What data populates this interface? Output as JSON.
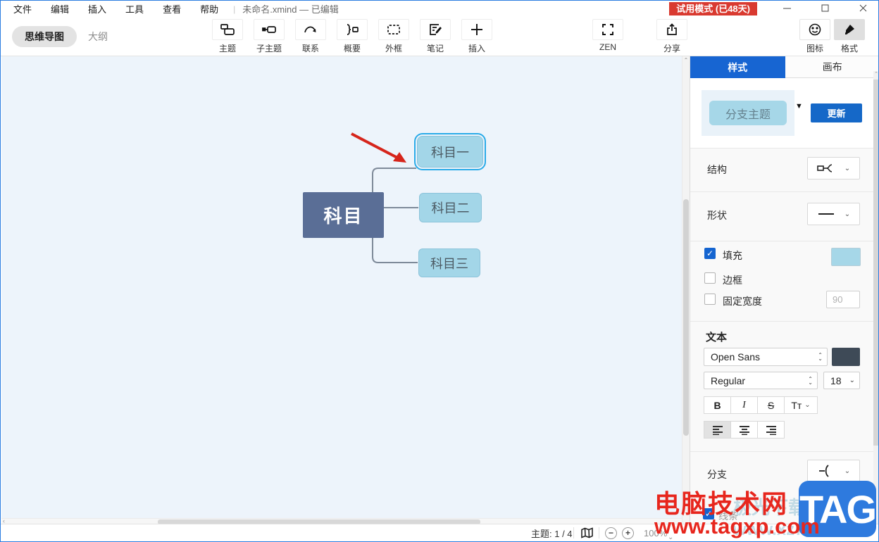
{
  "titlebar": {
    "menu_items": [
      "文件",
      "编辑",
      "插入",
      "工具",
      "查看",
      "帮助"
    ],
    "document_title": "未命名.xmind — 已编辑",
    "trial_badge": "试用模式 (已48天)",
    "trial_badge_color": "#d93a30"
  },
  "toolbar": {
    "view_tabs": [
      {
        "label": "思维导图",
        "active": true
      },
      {
        "label": "大纲",
        "active": false
      }
    ],
    "tools": [
      {
        "label": "主题"
      },
      {
        "label": "子主题"
      },
      {
        "label": "联系"
      },
      {
        "label": "概要"
      },
      {
        "label": "外框"
      },
      {
        "label": "笔记"
      },
      {
        "label": "插入"
      },
      {
        "label": "ZEN"
      },
      {
        "label": "分享"
      },
      {
        "label": "图标"
      },
      {
        "label": "格式"
      }
    ],
    "active_tool": "格式"
  },
  "canvas": {
    "background": "#edf4fb",
    "mindmap": {
      "root_label": "科目",
      "children": [
        "科目一",
        "科目二",
        "科目三"
      ],
      "selected_child": "科目一",
      "root_fill": "#5a6e96",
      "child_fill": "#a3d6e8",
      "selection_color": "#2aabe8",
      "connector_color": "#7e8a99",
      "arrow_color": "#d6251b"
    }
  },
  "panel": {
    "tabs": [
      {
        "label": "样式",
        "active": true
      },
      {
        "label": "画布",
        "active": false
      }
    ],
    "preview": {
      "label": "分支主题",
      "update_button": "更新",
      "pill_fill": "#a6d7e8",
      "button_color": "#1568c8"
    },
    "structure_row": {
      "label": "结构"
    },
    "shape_row": {
      "label": "形状"
    },
    "fill_row": {
      "label": "填充",
      "checked": true,
      "swatch": "#a6d7e8"
    },
    "border_row": {
      "label": "边框",
      "checked": false
    },
    "fixed_width_row": {
      "label": "固定宽度",
      "checked": false,
      "value": "90"
    },
    "text_section": {
      "title": "文本",
      "font_family": "Open Sans",
      "font_color": "#3e4a57",
      "font_weight": "Regular",
      "font_size": "18",
      "bold": "B",
      "italic": "I",
      "strike": "S",
      "case": "Tт"
    },
    "branch_row": {
      "label": "分支"
    },
    "line_row": {
      "label": "线条",
      "checked": true
    }
  },
  "statusbar": {
    "topics_label": "主题: 1 / 4",
    "zoom_value": "100%"
  },
  "watermark": {
    "site_name": "电脑技术网",
    "site_url": "www.tagxp.com",
    "badge": "TAG",
    "faint_name": "极光下载站",
    "faint_url": "www.xz7.com",
    "red": "#e7261d",
    "blue": "#2e7ade"
  }
}
